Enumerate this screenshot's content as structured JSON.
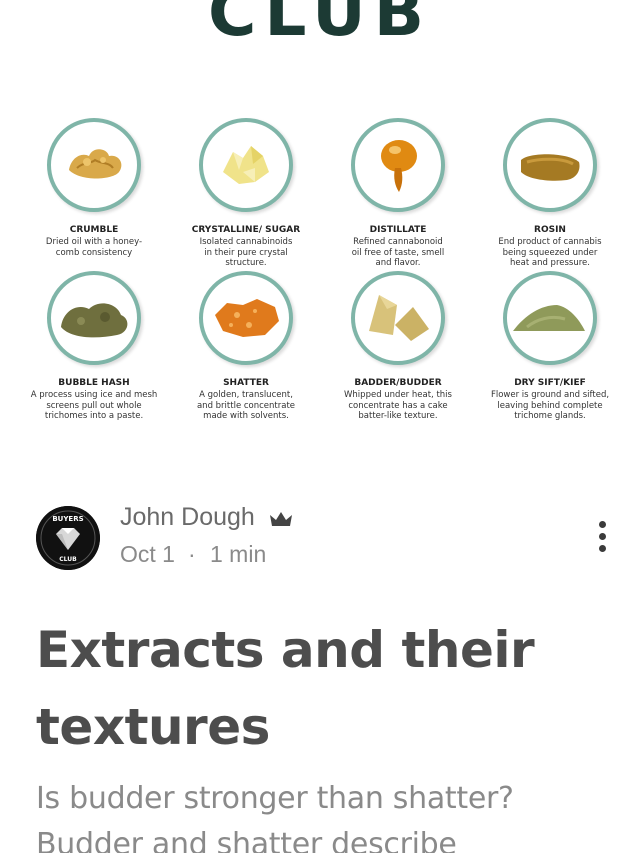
{
  "hero": {
    "title": "CLUB"
  },
  "extracts": [
    {
      "name": "CRUMBLE",
      "desc": [
        "Dried oil with a honey-",
        "comb consistency"
      ],
      "icon": "crumble-icon",
      "color": "#d9a94a"
    },
    {
      "name": "CRYSTALLINE/ SUGAR",
      "desc": [
        "Isolated cannabinoids",
        "in their pure crystal",
        "structure."
      ],
      "icon": "crystalline-icon",
      "color": "#f0e38a"
    },
    {
      "name": "DISTILLATE",
      "desc": [
        "Refined cannabonoid",
        "oil free of taste, smell",
        "and flavor."
      ],
      "icon": "distillate-icon",
      "color": "#e08a12"
    },
    {
      "name": "ROSIN",
      "desc": [
        "End product of cannabis",
        "being squeezed under",
        "heat and pressure."
      ],
      "icon": "rosin-icon",
      "color": "#a57a23"
    },
    {
      "name": "BUBBLE HASH",
      "desc": [
        "A process using ice and mesh",
        "screens pull out whole",
        "trichomes into a paste."
      ],
      "icon": "bubble-hash-icon",
      "color": "#6f6f3e"
    },
    {
      "name": "SHATTER",
      "desc": [
        "A golden, translucent,",
        "and brittle concentrate",
        "made with solvents."
      ],
      "icon": "shatter-icon",
      "color": "#e07a1c"
    },
    {
      "name": "BADDER/BUDDER",
      "desc": [
        "Whipped under heat, this",
        "concentrate has a cake",
        "batter-like texture."
      ],
      "icon": "badder-icon",
      "color": "#d8c27a"
    },
    {
      "name": "DRY SIFT/KIEF",
      "desc": [
        "Flower is ground and sifted,",
        "leaving behind complete",
        "trichome glands."
      ],
      "icon": "kief-icon",
      "color": "#8f9a5a"
    }
  ],
  "author": {
    "name": "John Dough",
    "avatar_text_top": "BUYERS",
    "avatar_text_bottom": "CLUB",
    "date": "Oct 1",
    "separator": "·",
    "read_time": "1 min"
  },
  "post": {
    "title": "Extracts and their textures",
    "excerpt": "Is budder stronger than shatter? Budder and shatter describe"
  },
  "colors": {
    "ring": "#7fb5a8",
    "title_dark": "#1c3a34",
    "title_gray": "#4d4d4d",
    "meta_gray": "#8a8a8a"
  }
}
